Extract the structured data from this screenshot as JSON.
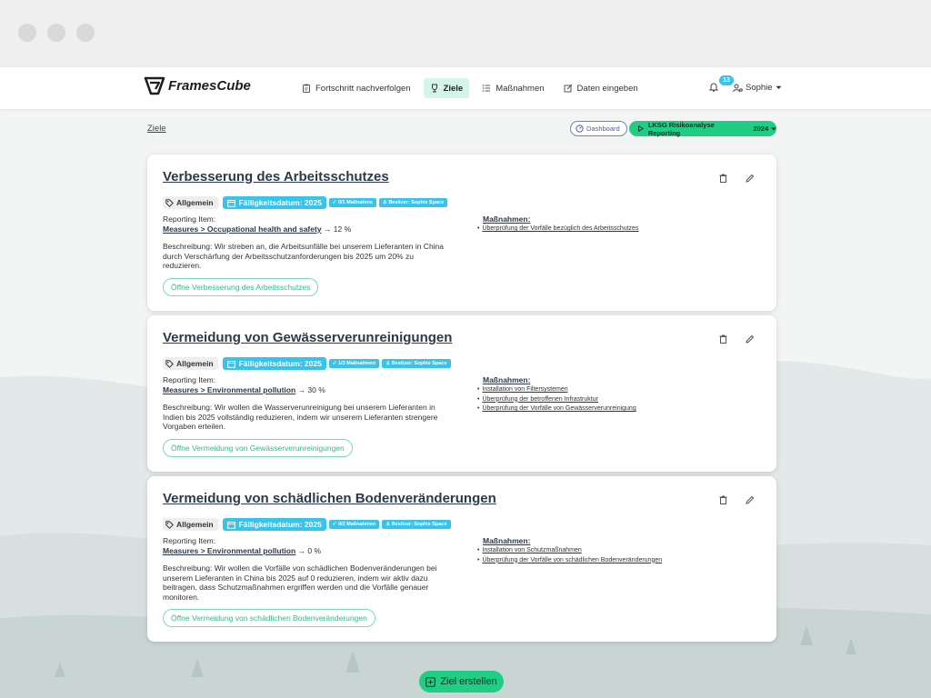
{
  "app": {
    "logo_text": "FramesCube"
  },
  "nav": {
    "items": [
      {
        "label": "Fortschritt nachverfolgen",
        "icon": "clipboard-icon",
        "active": false
      },
      {
        "label": "Ziele",
        "icon": "trophy-icon",
        "active": true
      },
      {
        "label": "Maßnahmen",
        "icon": "list-icon",
        "active": false
      },
      {
        "label": "Daten eingeben",
        "icon": "edit-icon",
        "active": false
      }
    ]
  },
  "header": {
    "notification_count": "13",
    "user_name": "Sophie"
  },
  "breadcrumb": {
    "label": "Ziele"
  },
  "toolbar": {
    "dashboard_label": "Dashboard",
    "report_label": "LKSG Risikoanalyse Reporting",
    "report_year": "2024"
  },
  "goals": [
    {
      "title": "Verbesserung des Arbeitsschutzes",
      "category": "Allgemein",
      "due": "Fälligkeitsdatum: 2025",
      "measures_count": "0/1 Maßnahme",
      "owner": "Besitzer: Sophie Space",
      "reporting_label": "Reporting Item:",
      "reporting_link": "Measures > Occupational health and safety",
      "reporting_value": "12 %",
      "description": "Beschreibung: Wir streben an, die Arbeitsunfälle bei unserem Lieferanten in China durch Verschärfung der Arbeitsschutzanforderungen bis 2025 um 20% zu reduzieren.",
      "open_label": "Öffne Verbesserung des Arbeitsschutzes",
      "measures_title": "Maßnahmen:",
      "measures": [
        "Überprüfung der Vorfälle bezüglich des Arbeitsschutzes"
      ]
    },
    {
      "title": "Vermeidung von Gewässerverunreinigungen",
      "category": "Allgemein",
      "due": "Fälligkeitsdatum: 2025",
      "measures_count": "1/3 Maßnahmen",
      "owner": "Besitzer: Sophie Space",
      "reporting_label": "Reporting Item:",
      "reporting_link": "Measures > Environmental pollution",
      "reporting_value": "30 %",
      "description": "Beschreibung: Wir wollen die Wasserverunreinigung bei unserem Lieferanten in Indien bis 2025 vollständig reduzieren, indem wir unserem Lieferanten strengere Vorgaben erteilen.",
      "open_label": "Öffne Vermeidung von Gewässerverunreinigungen",
      "measures_title": "Maßnahmen:",
      "measures": [
        "Installation von Filtersystemen",
        "Überprüfung der betroffenen Infrastruktur",
        "Überprüfung der Vorfälle von Gewässerverunreinigung"
      ]
    },
    {
      "title": "Vermeidung von schädlichen Bodenveränderungen",
      "category": "Allgemein",
      "due": "Fälligkeitsdatum: 2025",
      "measures_count": "0/2 Maßnahmen",
      "owner": "Besitzer: Sophie Space",
      "reporting_label": "Reporting Item:",
      "reporting_link": "Measures > Environmental pollution",
      "reporting_value": "0 %",
      "description": "Beschreibung: Wir wollen die Vorfälle von schädlichen Bodenveränderungen bei unserem Lieferanten in China bis 2025 auf 0 reduzieren, indem wir aktiv dazu beitragen, dass Schutzmaßnahmen ergriffen werden und die Vorfälle genauer monitoren.",
      "open_label": "Öffne Vermeidung von schädlichen Bodenveränderungen",
      "measures_title": "Maßnahmen:",
      "measures": [
        "Installation von Schutzmaßnahmen",
        "Überprüfung der Vorfälle von schädlichen Bodenveränderungen"
      ]
    }
  ],
  "create_button": {
    "label": "Ziel erstellen"
  },
  "colors": {
    "accent": "#1fce84",
    "info": "#38c3ea",
    "active_nav_bg": "#d5f5e9",
    "title": "#2b3a4a"
  }
}
